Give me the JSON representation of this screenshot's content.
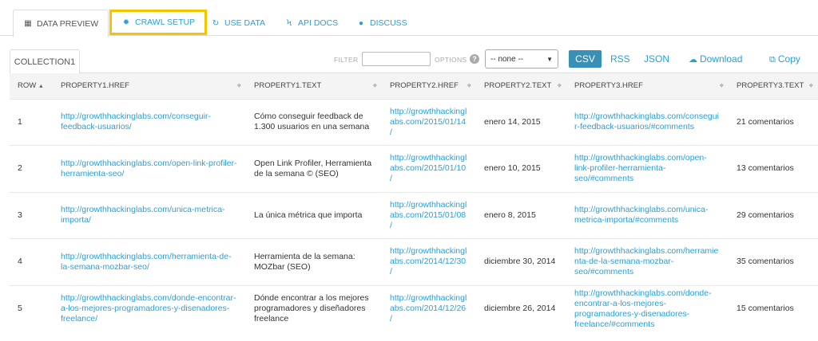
{
  "tabs": [
    {
      "label": "DATA PREVIEW",
      "icon": "table-icon"
    },
    {
      "label": "CRAWL SETUP",
      "icon": "gear-icon"
    },
    {
      "label": "USE DATA",
      "icon": "refresh-icon"
    },
    {
      "label": "API DOCS",
      "icon": "bolt-icon"
    },
    {
      "label": "DISCUSS",
      "icon": "comments-icon"
    }
  ],
  "toolbar": {
    "collection_tab": "COLLECTION1",
    "filter_label": "FILTER",
    "filter_value": "",
    "options_label": "OPTIONS",
    "select_value": "-- none --",
    "csv_label": "CSV",
    "rss_label": "RSS",
    "json_label": "JSON",
    "download_label": "Download",
    "copy_label": "Copy"
  },
  "table": {
    "columns": [
      "ROW",
      "PROPERTY1.HREF",
      "PROPERTY1.TEXT",
      "PROPERTY2.HREF",
      "PROPERTY2.TEXT",
      "PROPERTY3.HREF",
      "PROPERTY3.TEXT"
    ],
    "rows": [
      [
        "1",
        "http://growthhackinglabs.com/conseguir-feedback-usuarios/",
        "Cómo conseguir feedback de 1.300 usuarios en una semana",
        "http://growthhackinglabs.com/2015/01/14/",
        "enero 14, 2015",
        "http://growthhackinglabs.com/conseguir-feedback-usuarios/#comments",
        "21 comentarios"
      ],
      [
        "2",
        "http://growthhackinglabs.com/open-link-profiler-herramienta-seo/",
        "Open Link Profiler, Herramienta de la semana © (SEO)",
        "http://growthhackinglabs.com/2015/01/10/",
        "enero 10, 2015",
        "http://growthhackinglabs.com/open-link-profiler-herramienta-seo/#comments",
        "13 comentarios"
      ],
      [
        "3",
        "http://growthhackinglabs.com/unica-metrica-importa/",
        "La única métrica que importa",
        "http://growthhackinglabs.com/2015/01/08/",
        "enero 8, 2015",
        "http://growthhackinglabs.com/unica-metrica-importa/#comments",
        "29 comentarios"
      ],
      [
        "4",
        "http://growthhackinglabs.com/herramienta-de-la-semana-mozbar-seo/",
        "Herramienta de la semana: MOZbar (SEO)",
        "http://growthhackinglabs.com/2014/12/30/",
        "diciembre 30, 2014",
        "http://growthhackinglabs.com/herramienta-de-la-semana-mozbar-seo/#comments",
        "35 comentarios"
      ],
      [
        "5",
        "http://growthhackinglabs.com/donde-encontrar-a-los-mejores-programadores-y-disenadores-freelance/",
        "Dónde encontrar a los mejores programadores y diseñadores freelance",
        "http://growthhackinglabs.com/2014/12/26/",
        "diciembre 26, 2014",
        "http://growthhackinglabs.com/donde-encontrar-a-los-mejores-programadores-y-disenadores-freelance/#comments",
        "15 comentarios"
      ]
    ]
  }
}
